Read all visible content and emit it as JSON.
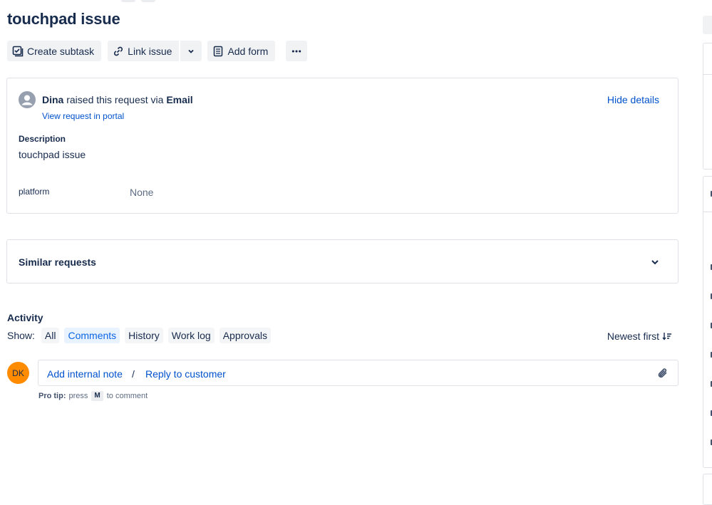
{
  "issue": {
    "title": "touchpad issue"
  },
  "toolbar": {
    "create_subtask": "Create subtask",
    "link_issue": "Link issue",
    "add_form": "Add form"
  },
  "request": {
    "reporter": "Dina",
    "raised_text": "raised this request via",
    "channel": "Email",
    "portal_link": "View request in portal",
    "hide_details": "Hide details",
    "description_label": "Description",
    "description_value": "touchpad issue",
    "platform_label": "platform",
    "platform_value": "None"
  },
  "similar": {
    "label": "Similar requests"
  },
  "activity": {
    "label": "Activity",
    "show_label": "Show:",
    "filters": [
      "All",
      "Comments",
      "History",
      "Work log",
      "Approvals"
    ],
    "active_filter": "Comments",
    "sort": "Newest first"
  },
  "comment": {
    "avatar_initials": "DK",
    "avatar_color": "#ff8b00",
    "internal_note": "Add internal note",
    "separator": "/",
    "reply": "Reply to customer",
    "protip_label": "Pro tip:",
    "protip_pre": "press",
    "protip_key": "M",
    "protip_post": "to comment"
  },
  "colors": {
    "link": "#0052cc",
    "text": "#172b4d",
    "border": "#dfe1e6"
  }
}
